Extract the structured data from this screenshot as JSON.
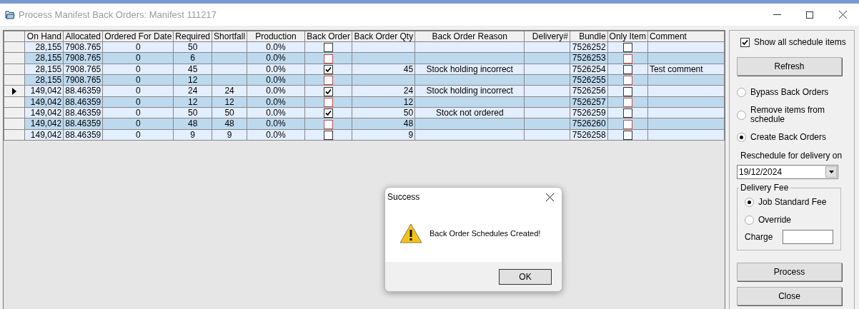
{
  "window": {
    "title": "Process Manifest Back Orders: Manifest 111217"
  },
  "table": {
    "columns": [
      "On Hand",
      "Allocated",
      "Ordered For Date",
      "Required",
      "Shortfall",
      "Production",
      "Back Order",
      "Back Order Qty",
      "Back Order Reason",
      "Delivery#",
      "Bundle",
      "Only Item",
      "Comment"
    ],
    "rows": [
      {
        "current": false,
        "on_hand": "28,155",
        "allocated": "7908.765",
        "ordered_for_date": "0",
        "required": "50",
        "production": "0.0%",
        "back_order": false,
        "bundle": "7526252",
        "only_item": false
      },
      {
        "current": false,
        "on_hand": "28,155",
        "allocated": "7908.765",
        "ordered_for_date": "0",
        "required": "6",
        "production": "0.0%",
        "back_order": false,
        "bundle": "7526253",
        "only_item": false
      },
      {
        "current": false,
        "on_hand": "28,155",
        "allocated": "7908.765",
        "ordered_for_date": "0",
        "required": "45",
        "production": "0.0%",
        "back_order": true,
        "back_order_qty": "45",
        "back_order_reason": "Stock holding incorrect",
        "bundle": "7526254",
        "only_item": false,
        "comment": "Test comment"
      },
      {
        "current": false,
        "on_hand": "28,155",
        "allocated": "7908.765",
        "ordered_for_date": "0",
        "required": "12",
        "production": "0.0%",
        "back_order": false,
        "bundle": "7526255",
        "only_item": false
      },
      {
        "current": true,
        "on_hand": "149,042",
        "allocated": "88.46359",
        "ordered_for_date": "0",
        "required": "24",
        "shortfall": "24",
        "production": "0.0%",
        "back_order": true,
        "back_order_qty": "24",
        "back_order_reason": "Stock holding incorrect",
        "bundle": "7526256",
        "only_item": false
      },
      {
        "current": false,
        "on_hand": "149,042",
        "allocated": "88.46359",
        "ordered_for_date": "0",
        "required": "12",
        "shortfall": "12",
        "production": "0.0%",
        "back_order": false,
        "back_order_qty": "12",
        "bundle": "7526257",
        "only_item": false
      },
      {
        "current": false,
        "on_hand": "149,042",
        "allocated": "88.46359",
        "ordered_for_date": "0",
        "required": "50",
        "shortfall": "50",
        "production": "0.0%",
        "back_order": true,
        "back_order_qty": "50",
        "back_order_reason": "Stock not ordered",
        "bundle": "7526259",
        "only_item": false
      },
      {
        "current": false,
        "on_hand": "149,042",
        "allocated": "88.46359",
        "ordered_for_date": "0",
        "required": "48",
        "shortfall": "48",
        "production": "0.0%",
        "back_order": false,
        "back_order_qty": "48",
        "bundle": "7526260",
        "only_item": false
      },
      {
        "current": false,
        "on_hand": "149,042",
        "allocated": "88.46359",
        "ordered_for_date": "0",
        "required": "9",
        "shortfall": "9",
        "production": "0.0%",
        "back_order": false,
        "back_order_qty": "9",
        "bundle": "7526258",
        "only_item": false
      }
    ]
  },
  "side_panel": {
    "show_all": {
      "label": "Show all schedule items",
      "checked": true
    },
    "refresh_button": "Refresh",
    "options": [
      {
        "label": "Bypass Back Orders",
        "selected": false
      },
      {
        "label": "Remove items from schedule",
        "selected": false
      },
      {
        "label": "Create Back Orders",
        "selected": true
      }
    ],
    "reschedule_label": "Reschedule for delivery on",
    "delivery_date": "19/12/2024",
    "delivery_fee": {
      "title": "Delivery Fee",
      "options": [
        {
          "label": "Job Standard Fee",
          "selected": true
        },
        {
          "label": "Override",
          "selected": false
        }
      ],
      "charge_label": "Charge"
    },
    "process_button": "Process",
    "close_button": "Close"
  },
  "dialog": {
    "title": "Success",
    "message": "Back Order Schedules Created!",
    "ok_button": "OK"
  }
}
